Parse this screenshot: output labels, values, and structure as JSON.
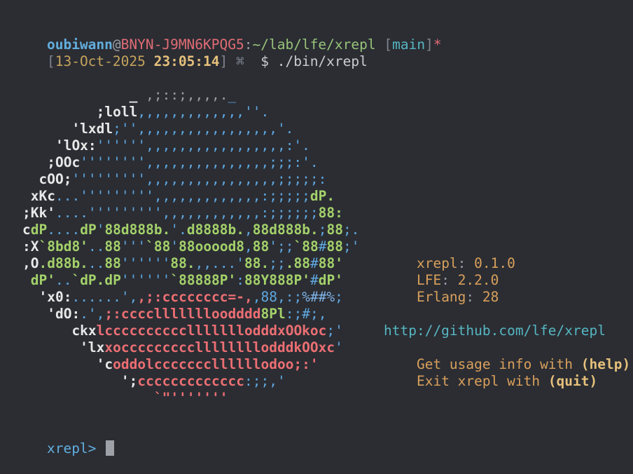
{
  "colors": {
    "background": "#2b2d33",
    "user": "#62aede",
    "host": "#e06c75",
    "path": "#98c379",
    "branch": "#56b6c2",
    "dirty": "#e06c75",
    "bracket": "#7f848e",
    "date": "#c6a35c",
    "time": "#e5c07b",
    "white": "#e8e8e8",
    "gray": "#9a9ea6",
    "blue": "#5fa8e0",
    "green": "#a4d16a",
    "red": "#ec6f73",
    "yellow": "#e5c07b",
    "orange": "#d9a05b",
    "lightblue": "#7fb4e8"
  },
  "prompt": {
    "user": "oubiwann",
    "at": "@",
    "host": "BNYN-J9MN6KPQG5",
    "colon": ":",
    "path": "~/lab/lfe/xrepl",
    "branch_open": " [",
    "branch": "main",
    "branch_close": "]",
    "dirty_mark": "*",
    "date_open": "[",
    "date": "13-Oct-2025 ",
    "time": "23:05:14",
    "date_close": "]",
    "symbol": " ⌘  ",
    "command": "$ ./bin/xrepl"
  },
  "art": [
    [
      [
        "             _ ",
        "white"
      ],
      [
        ",;::;,,,,.",
        "gray"
      ],
      [
        "_",
        "blue"
      ]
    ],
    [
      [
        "         ;loll",
        "white"
      ],
      [
        ",,,,,,,,,,,,,''.",
        "blue"
      ]
    ],
    [
      [
        "      'lxdl",
        "white"
      ],
      [
        ";'',,,,,,,,,,,,,,,,,'.",
        "blue"
      ]
    ],
    [
      [
        "    'lOx:",
        "white"
      ],
      [
        "'''''',,,,,,,,,,,,,,,,,:'.",
        "blue"
      ]
    ],
    [
      [
        "   ;OOc",
        "white"
      ],
      [
        "'''''''',,,,,,,,,,,,,,,;;;:'.",
        "blue"
      ]
    ],
    [
      [
        "  cOO;",
        "white"
      ],
      [
        "''''''''',,,,,,,,,,,,,,,,;;;;;:",
        "blue"
      ]
    ],
    [
      [
        " xKc",
        "white"
      ],
      [
        "...''''''''',,,,,,,,,,,,,:;;;;;",
        "blue"
      ],
      [
        "dP.",
        "green"
      ]
    ],
    [
      [
        ";Kk'",
        "white"
      ],
      [
        "....''''''''',,,,,,,,,,,,:;;;;;;",
        "blue"
      ],
      [
        "88:",
        "green"
      ]
    ],
    [
      [
        "c",
        "white"
      ],
      [
        "dP",
        "green"
      ],
      [
        "....",
        "blue"
      ],
      [
        "dP",
        "green"
      ],
      [
        "'",
        "blue"
      ],
      [
        "88d888b.",
        "green"
      ],
      [
        "'.",
        "blue"
      ],
      [
        "d8888b.",
        "green"
      ],
      [
        ",",
        "blue"
      ],
      [
        "88d888b.",
        "green"
      ],
      [
        ";",
        "blue"
      ],
      [
        "88",
        "green"
      ],
      [
        ";.",
        "blue"
      ]
    ],
    [
      [
        ":X",
        "white"
      ],
      [
        "`8bd8'",
        "green"
      ],
      [
        "..",
        "blue"
      ],
      [
        "88",
        "green"
      ],
      [
        "'''",
        "blue"
      ],
      [
        "`88",
        "green"
      ],
      [
        "'",
        "blue"
      ],
      [
        "88ooood8",
        "green"
      ],
      [
        ",",
        "blue"
      ],
      [
        "88",
        "green"
      ],
      [
        "';;",
        "blue"
      ],
      [
        "`88",
        "green"
      ],
      [
        "#",
        "blue"
      ],
      [
        "88",
        "green"
      ],
      [
        ";'",
        "blue"
      ]
    ],
    [
      [
        ",O",
        "white"
      ],
      [
        ".d88b.",
        "green"
      ],
      [
        "..",
        "blue"
      ],
      [
        "88",
        "green"
      ],
      [
        "''''''",
        "blue"
      ],
      [
        "88.",
        "green"
      ],
      [
        ",,...'",
        "blue"
      ],
      [
        "88.",
        "green"
      ],
      [
        ";;",
        "blue"
      ],
      [
        ".88",
        "green"
      ],
      [
        "#",
        "blue"
      ],
      [
        "88'",
        "green"
      ]
    ],
    [
      [
        " dP'",
        "green"
      ],
      [
        "..",
        "blue"
      ],
      [
        "`dP.dP",
        "green"
      ],
      [
        "''''''",
        "blue"
      ],
      [
        "`88888P'",
        "green"
      ],
      [
        ":",
        "blue"
      ],
      [
        "88Y888P'",
        "green"
      ],
      [
        "#",
        "blue"
      ],
      [
        "dP'",
        "green"
      ]
    ],
    [
      [
        "  'x0:",
        "white"
      ],
      [
        "......',",
        "blue"
      ],
      [
        ",;:cccccccc=-,",
        "red"
      ],
      [
        ",88,",
        "blue"
      ],
      [
        ":;",
        "blue"
      ],
      [
        "%##%",
        "lightblue"
      ],
      [
        ";",
        "blue"
      ]
    ],
    [
      [
        "   'dO:",
        "white"
      ],
      [
        ".',",
        "blue"
      ],
      [
        ";:ccc",
        "red"
      ],
      [
        "clllllll",
        "red"
      ],
      [
        "oodddd",
        "red"
      ],
      [
        "8Pl",
        "green"
      ],
      [
        ":;#;,",
        "blue"
      ]
    ],
    [
      [
        "      ckx",
        "white"
      ],
      [
        "lccccccccc",
        "red"
      ],
      [
        "clllllll",
        "red"
      ],
      [
        "odddxOOkoc",
        "red"
      ],
      [
        ";'",
        "blue"
      ]
    ],
    [
      [
        "       'lx",
        "white"
      ],
      [
        "xoccccccccc",
        "red"
      ],
      [
        "llllllll",
        "red"
      ],
      [
        "odddkOOxc",
        "red"
      ],
      [
        "'",
        "blue"
      ]
    ],
    [
      [
        "         'c",
        "white"
      ],
      [
        "oddolcccccc",
        "red"
      ],
      [
        "cllllll",
        "red"
      ],
      [
        "odoo;:'",
        "red"
      ]
    ],
    [
      [
        "            ';",
        "white"
      ],
      [
        "ccccccccccc",
        "red"
      ],
      [
        "cc",
        "red"
      ],
      [
        ":;;,'",
        "blue"
      ]
    ],
    [
      [
        "                `\"'''''''",
        "red"
      ]
    ]
  ],
  "info": {
    "version_label": "xrepl",
    "version_sep": ": ",
    "version": "0.1.0",
    "lfe_label": "LFE",
    "lfe_sep": ": ",
    "lfe": "2.2.0",
    "erlang_label": "Erlang",
    "erlang_sep": ": ",
    "erlang": "28",
    "url": "http://github.com/lfe/xrepl",
    "usage_text": "Get usage info with ",
    "usage_cmd": "(help)",
    "exit_text": "Exit xrepl with ",
    "exit_cmd": "(quit)"
  },
  "repl_prompt": "xrepl> "
}
